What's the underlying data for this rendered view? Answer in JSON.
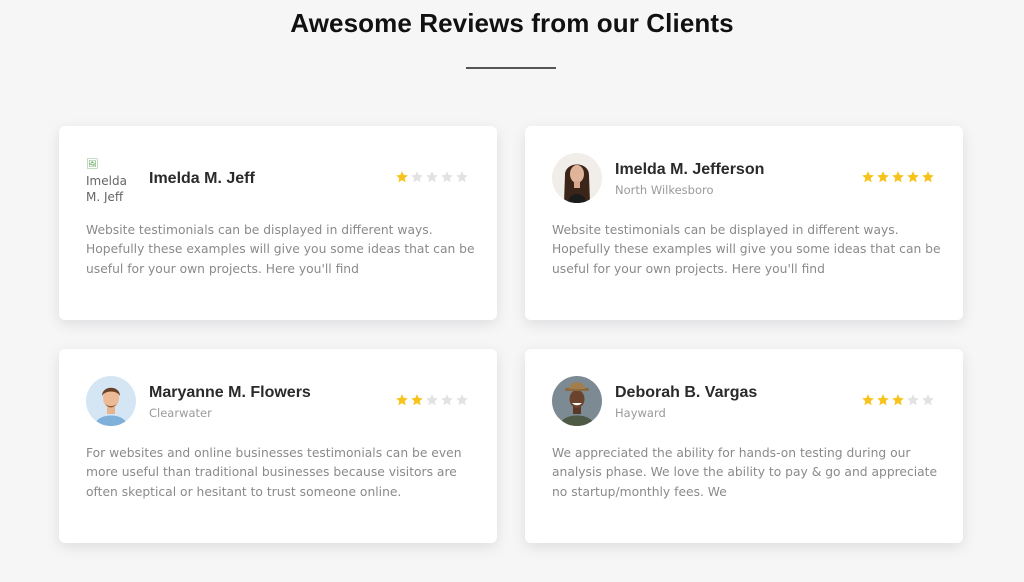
{
  "header": {
    "title": "Awesome Reviews from our Clients"
  },
  "colors": {
    "star_filled": "#f7c31a",
    "star_empty": "#e2e2e2",
    "card_bg": "#ffffff",
    "page_bg": "#f6f6f7"
  },
  "reviews": [
    {
      "name": "Imelda M. Jeff",
      "location": "",
      "avatar_alt": "Imelda M. Jeff",
      "rating": 1,
      "text": "Website testimonials can be displayed in different ways. Hopefully these examples will give you some ideas that can be useful for your own projects. Here you'll find"
    },
    {
      "name": "Imelda M. Jefferson",
      "location": "North Wilkesboro",
      "rating": 5,
      "text": "Website testimonials can be displayed in different ways. Hopefully these examples will give you some ideas that can be useful for your own projects. Here you'll find"
    },
    {
      "name": "Maryanne M. Flowers",
      "location": "Clearwater",
      "rating": 2,
      "text": "For websites and online businesses testimonials can be even more useful than traditional businesses because visitors are often skeptical or hesitant to trust someone online."
    },
    {
      "name": "Deborah B. Vargas",
      "location": "Hayward",
      "rating": 3,
      "text": "We appreciated the ability for hands-on testing during our analysis phase. We love the ability to pay & go and appreciate no startup/monthly fees. We"
    }
  ]
}
